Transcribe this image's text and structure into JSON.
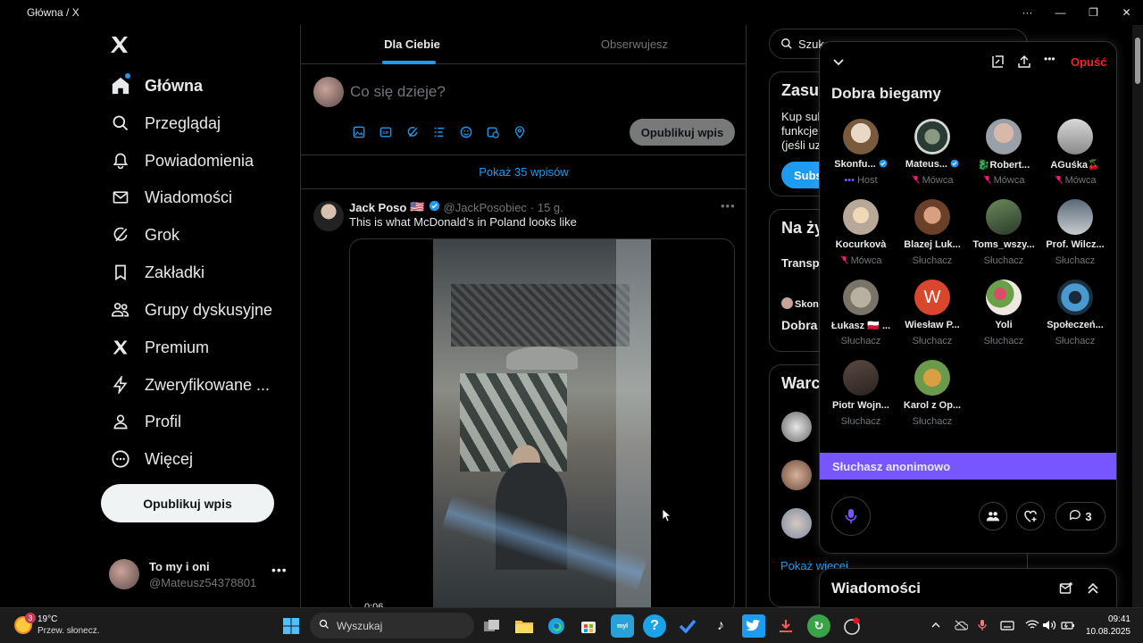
{
  "window": {
    "title": "Główna / X",
    "controls": [
      "more-icon",
      "minimize-icon",
      "restore-icon",
      "close-icon"
    ]
  },
  "sidebar": {
    "items": [
      {
        "label": "Główna",
        "icon": "home-icon",
        "active": true
      },
      {
        "label": "Przeglądaj",
        "icon": "search-icon"
      },
      {
        "label": "Powiadomienia",
        "icon": "bell-icon"
      },
      {
        "label": "Wiadomości",
        "icon": "mail-icon"
      },
      {
        "label": "Grok",
        "icon": "grok-icon"
      },
      {
        "label": "Zakładki",
        "icon": "bookmark-icon"
      },
      {
        "label": "Grupy dyskusyjne",
        "icon": "communities-icon"
      },
      {
        "label": "Premium",
        "icon": "x-icon"
      },
      {
        "label": "Zweryfikowane ...",
        "icon": "lightning-icon"
      },
      {
        "label": "Profil",
        "icon": "person-icon"
      },
      {
        "label": "Więcej",
        "icon": "more-circle-icon"
      }
    ],
    "post_button": "Opublikuj wpis",
    "account": {
      "name": "To my i oni",
      "handle": "@Mateusz54378801"
    }
  },
  "main": {
    "tabs": [
      {
        "label": "Dla Ciebie",
        "active": true
      },
      {
        "label": "Obserwujesz",
        "active": false
      }
    ],
    "compose": {
      "placeholder": "Co się dzieje?",
      "post_button": "Opublikuj wpis",
      "tools": [
        "image-icon",
        "gif-icon",
        "grok-icon",
        "poll-icon",
        "emoji-icon",
        "schedule-icon",
        "location-icon"
      ]
    },
    "show_more": "Pokaż 35 wpisów",
    "tweet": {
      "author": "Jack Poso",
      "flag": "🇺🇸",
      "handle": "@JackPosobiec",
      "time": "· 15 g.",
      "text": "This is what McDonald’s in Poland looks like",
      "video_time": "0:06"
    }
  },
  "right": {
    "search_text": "Szuka",
    "premium_card": {
      "title": "Zasul",
      "lines": [
        "Kup sub",
        "funkcje",
        "(jeśli uz"
      ],
      "button": "Subs"
    },
    "live_card": {
      "title": "Na ży",
      "line1": "Transp",
      "host_short": "Skon",
      "space_short": "Dobra l"
    },
    "follow_card": {
      "title": "Warc",
      "show_more": "Pokaż więcej"
    }
  },
  "space": {
    "title": "Dobra biegamy",
    "leave_label": "Opuść",
    "participants": [
      {
        "name": "Skonfu...",
        "role": "Host",
        "role_icon": "host-dots-icon",
        "verified": true
      },
      {
        "name": "Mateus...",
        "role": "Mówca",
        "role_icon": "mic-muted-icon",
        "verified": true
      },
      {
        "name": "🐉Robert...",
        "role": "Mówca",
        "role_icon": "mic-muted-icon"
      },
      {
        "name": "AGuśka🍒",
        "role": "Mówca",
        "role_icon": "mic-muted-icon"
      },
      {
        "name": "Kocurkovà",
        "role": "Mówca",
        "role_icon": "mic-muted-icon"
      },
      {
        "name": "Blazej Luk...",
        "role": "Słuchacz"
      },
      {
        "name": "Toms_wszy...",
        "role": "Słuchacz"
      },
      {
        "name": "Prof. Wilcz...",
        "role": "Słuchacz"
      },
      {
        "name": "Łukasz 🇵🇱 ...",
        "role": "Słuchacz"
      },
      {
        "name": "Wiesław P...",
        "role": "Słuchacz",
        "initial": "W"
      },
      {
        "name": "Yoli",
        "role": "Słuchacz"
      },
      {
        "name": "Społeczeń...",
        "role": "Słuchacz"
      },
      {
        "name": "Piotr Wojn...",
        "role": "Słuchacz"
      },
      {
        "name": "Karol z Op...",
        "role": "Słuchacz"
      }
    ],
    "anon_banner": "Słuchasz anonimowo",
    "comment_count": "3"
  },
  "messages": {
    "title": "Wiadomości"
  },
  "taskbar": {
    "weather": {
      "temp": "19°C",
      "desc": "Przew. słonecz.",
      "badge": "3"
    },
    "search_placeholder": "Wyszukaj",
    "clock": {
      "time": "09:41",
      "date": "10.08.2025"
    }
  },
  "colors": {
    "accent": "#1d9bf0",
    "leave": "#f4212e",
    "anon": "#7856ff",
    "bg": "#000000"
  }
}
